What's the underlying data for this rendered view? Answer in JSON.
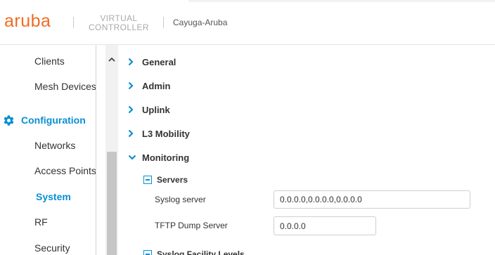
{
  "header": {
    "logo": "aruba",
    "product_line1": "VIRTUAL",
    "product_line2": "CONTROLLER",
    "cluster_name": "Cayuga-Aruba"
  },
  "sidebar": {
    "items_top": [
      {
        "label": "Clients"
      },
      {
        "label": "Mesh Devices"
      }
    ],
    "section": {
      "label": "Configuration",
      "icon": "gear-icon"
    },
    "items": [
      {
        "label": "Networks"
      },
      {
        "label": "Access Points"
      },
      {
        "label": "System"
      },
      {
        "label": "RF"
      },
      {
        "label": "Security"
      }
    ]
  },
  "main": {
    "accordions": [
      {
        "label": "General",
        "expanded": false
      },
      {
        "label": "Admin",
        "expanded": false
      },
      {
        "label": "Uplink",
        "expanded": false
      },
      {
        "label": "L3 Mobility",
        "expanded": false
      },
      {
        "label": "Monitoring",
        "expanded": true
      }
    ],
    "servers": {
      "label": "Servers",
      "fields": [
        {
          "label": "Syslog server",
          "value": "0.0.0.0,0.0.0.0,0.0.0.0"
        },
        {
          "label": "TFTP Dump Server",
          "value": "0.0.0.0"
        }
      ]
    },
    "next_section_label": "Syslog Facility Levels"
  },
  "colors": {
    "brand": "#f26b21",
    "accent": "#0a8fd3",
    "text": "#333333"
  }
}
